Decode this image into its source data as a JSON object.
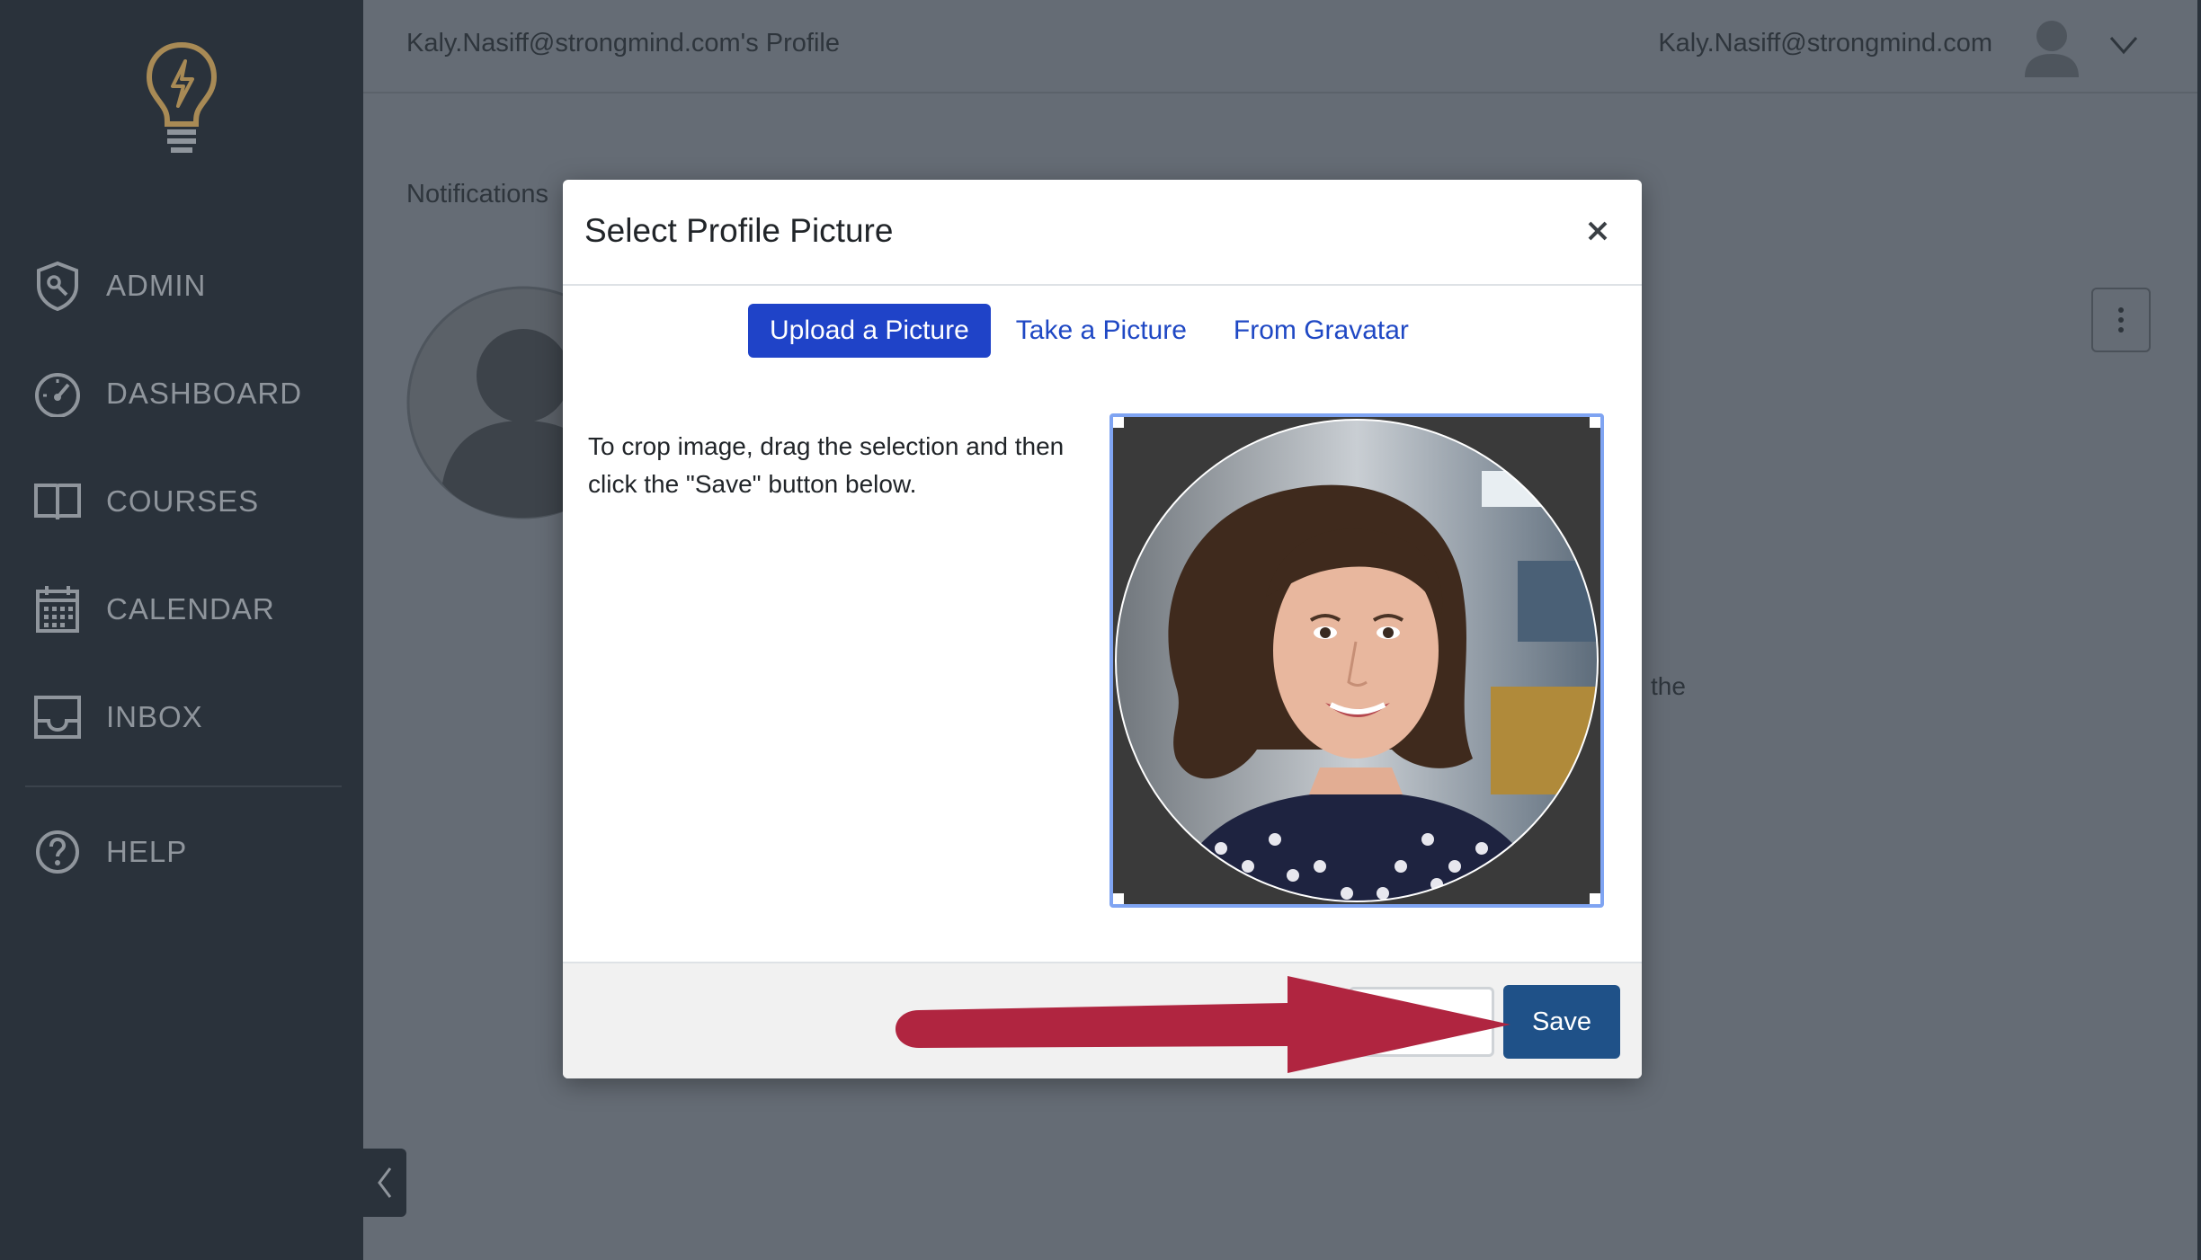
{
  "header": {
    "profile_title": "Kaly.Nasiff@strongmind.com's Profile",
    "user_email": "Kaly.Nasiff@strongmind.com"
  },
  "sidebar": {
    "items": [
      {
        "label": "ADMIN",
        "icon": "admin-shield-icon"
      },
      {
        "label": "DASHBOARD",
        "icon": "dashboard-gauge-icon"
      },
      {
        "label": "COURSES",
        "icon": "book-icon"
      },
      {
        "label": "CALENDAR",
        "icon": "calendar-icon"
      },
      {
        "label": "INBOX",
        "icon": "inbox-icon"
      },
      {
        "label": "HELP",
        "icon": "help-icon"
      }
    ]
  },
  "background": {
    "notifications_label": "Notifications",
    "partial_text": "the"
  },
  "modal": {
    "title": "Select Profile Picture",
    "tabs": [
      {
        "label": "Upload a Picture",
        "active": true
      },
      {
        "label": "Take a Picture",
        "active": false
      },
      {
        "label": "From Gravatar",
        "active": false
      }
    ],
    "instructions": "To crop image, drag the selection and then click the \"Save\" button below.",
    "save_label": "Save",
    "cancel_label": ""
  },
  "colors": {
    "sidebar_bg": "#2a323b",
    "overlay_bg": "#656c75",
    "tab_active": "#1f43c8",
    "save_button": "#1f5188",
    "annotation_arrow": "#b02540",
    "logo_gold": "#a88a55"
  }
}
